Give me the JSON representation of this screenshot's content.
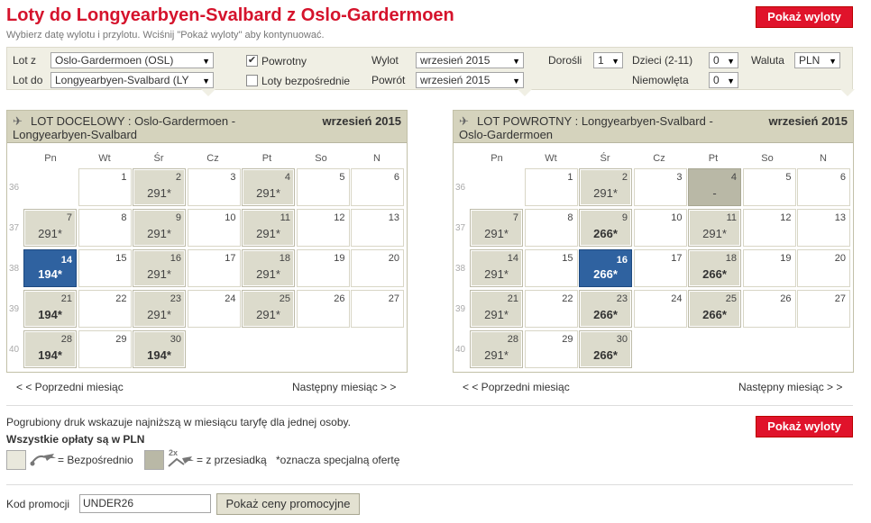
{
  "header": {
    "title": "Loty do Longyearbyen-Svalbard z Oslo-Gardermoen",
    "subtitle": "Wybierz datę wylotu i przylotu. Wciśnij \"Pokaż wyloty\" aby kontynuować.",
    "show_flights": "Pokaż wyloty"
  },
  "form": {
    "from_label": "Lot z",
    "from_value": "Oslo-Gardermoen (OSL)",
    "to_label": "Lot do",
    "to_value": "Longyearbyen-Svalbard (LY",
    "return_label": "Powrotny",
    "return_checked": true,
    "direct_label": "Loty bezpośrednie",
    "direct_checked": false,
    "depart_label": "Wylot",
    "depart_value": "wrzesień 2015",
    "return_date_label": "Powrót",
    "return_date_value": "wrzesień 2015",
    "adults_label": "Dorośli",
    "adults_value": "1",
    "children_label": "Dzieci (2-11)",
    "children_value": "0",
    "infants_label": "Niemowlęta",
    "infants_value": "0",
    "currency_label": "Waluta",
    "currency_value": "PLN"
  },
  "day_names": [
    "Pn",
    "Wt",
    "Śr",
    "Cz",
    "Pt",
    "So",
    "N"
  ],
  "week_numbers": [
    "36",
    "37",
    "38",
    "39",
    "40"
  ],
  "outbound": {
    "title": "LOT DOCELOWY :  Oslo-Gardermoen - Longyearbyen-Svalbard",
    "month": "wrzesień 2015",
    "prev": "< < Poprzedni miesiąc",
    "next": "Następny miesiąc > >",
    "days": [
      {
        "d": "1",
        "p": ""
      },
      {
        "d": "2",
        "p": "291*"
      },
      {
        "d": "3",
        "p": ""
      },
      {
        "d": "4",
        "p": "291*"
      },
      {
        "d": "5",
        "p": ""
      },
      {
        "d": "6",
        "p": ""
      },
      {
        "d": "7",
        "p": "291*"
      },
      {
        "d": "8",
        "p": ""
      },
      {
        "d": "9",
        "p": "291*"
      },
      {
        "d": "10",
        "p": ""
      },
      {
        "d": "11",
        "p": "291*"
      },
      {
        "d": "12",
        "p": ""
      },
      {
        "d": "13",
        "p": ""
      },
      {
        "d": "14",
        "p": "194*",
        "selected": true
      },
      {
        "d": "15",
        "p": ""
      },
      {
        "d": "16",
        "p": "291*"
      },
      {
        "d": "17",
        "p": ""
      },
      {
        "d": "18",
        "p": "291*"
      },
      {
        "d": "19",
        "p": ""
      },
      {
        "d": "20",
        "p": ""
      },
      {
        "d": "21",
        "p": "194*",
        "bold": true
      },
      {
        "d": "22",
        "p": ""
      },
      {
        "d": "23",
        "p": "291*"
      },
      {
        "d": "24",
        "p": ""
      },
      {
        "d": "25",
        "p": "291*"
      },
      {
        "d": "26",
        "p": ""
      },
      {
        "d": "27",
        "p": ""
      },
      {
        "d": "28",
        "p": "194*",
        "bold": true
      },
      {
        "d": "29",
        "p": ""
      },
      {
        "d": "30",
        "p": "194*",
        "bold": true
      }
    ]
  },
  "inbound": {
    "title": "LOT POWROTNY :  Longyearbyen-Svalbard - Oslo-Gardermoen",
    "month": "wrzesień 2015",
    "prev": "< < Poprzedni miesiąc",
    "next": "Następny miesiąc > >",
    "days": [
      {
        "d": "1",
        "p": ""
      },
      {
        "d": "2",
        "p": "291*"
      },
      {
        "d": "3",
        "p": ""
      },
      {
        "d": "4",
        "p": "-",
        "nodata": true
      },
      {
        "d": "5",
        "p": ""
      },
      {
        "d": "6",
        "p": ""
      },
      {
        "d": "7",
        "p": "291*"
      },
      {
        "d": "8",
        "p": ""
      },
      {
        "d": "9",
        "p": "266*",
        "bold": true
      },
      {
        "d": "10",
        "p": ""
      },
      {
        "d": "11",
        "p": "291*"
      },
      {
        "d": "12",
        "p": ""
      },
      {
        "d": "13",
        "p": ""
      },
      {
        "d": "14",
        "p": "291*"
      },
      {
        "d": "15",
        "p": ""
      },
      {
        "d": "16",
        "p": "266*",
        "selected": true
      },
      {
        "d": "17",
        "p": ""
      },
      {
        "d": "18",
        "p": "266*",
        "bold": true
      },
      {
        "d": "19",
        "p": ""
      },
      {
        "d": "20",
        "p": ""
      },
      {
        "d": "21",
        "p": "291*"
      },
      {
        "d": "22",
        "p": ""
      },
      {
        "d": "23",
        "p": "266*",
        "bold": true
      },
      {
        "d": "24",
        "p": ""
      },
      {
        "d": "25",
        "p": "266*",
        "bold": true
      },
      {
        "d": "26",
        "p": ""
      },
      {
        "d": "27",
        "p": ""
      },
      {
        "d": "28",
        "p": "291*"
      },
      {
        "d": "29",
        "p": ""
      },
      {
        "d": "30",
        "p": "266*",
        "bold": true
      }
    ]
  },
  "footer": {
    "bold_note": "Pogrubiony druk wskazuje najniższą w miesiącu taryfę dla jednej osoby.",
    "currency_note": "Wszystkie opłaty są w PLN",
    "direct_legend": "= Bezpośrednio",
    "stop_badge": "2x",
    "stop_legend": "= z przesiadką",
    "special_legend": "*oznacza specjalną ofertę",
    "promo_label": "Kod promocji",
    "promo_value": "UNDER26",
    "promo_button": "Pokaż ceny promocyjne"
  },
  "colors": {
    "accent": "#e0132b",
    "selected": "#2f62a0",
    "price_cell": "#dcdbcc"
  }
}
